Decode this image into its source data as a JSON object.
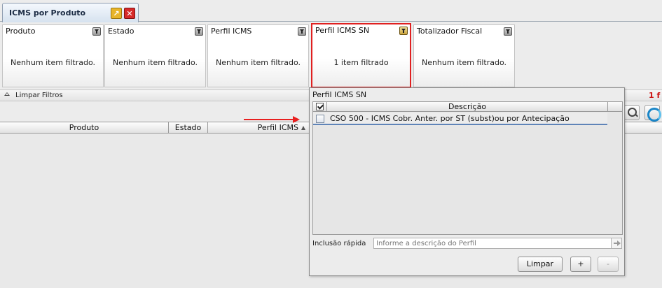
{
  "tab": {
    "title": "ICMS por Produto"
  },
  "filters": [
    {
      "title": "Produto",
      "status": "Nenhum item filtrado."
    },
    {
      "title": "Estado",
      "status": "Nenhum item filtrado."
    },
    {
      "title": "Perfil ICMS",
      "status": "Nenhum item filtrado."
    },
    {
      "title": "Perfil ICMS SN",
      "status": "1 item filtrado"
    },
    {
      "title": "Totalizador Fiscal",
      "status": "Nenhum item filtrado."
    }
  ],
  "clear_filters": {
    "label": "Limpar Filtros",
    "count_partial": "1 f"
  },
  "table": {
    "columns": [
      "Produto",
      "Estado",
      "Perfil ICMS"
    ]
  },
  "popup": {
    "title": "Perfil ICMS SN",
    "list_header": "Descrição",
    "items": [
      {
        "label": "CSO 500 - ICMS Cobr. Anter. por ST (subst)ou por Antecipação",
        "checked": false
      }
    ],
    "quick_add_label": "Inclusão rápida",
    "quick_add_placeholder": "Informe a descrição do Perfil",
    "buttons": {
      "clear": "Limpar",
      "add": "+",
      "remove": "-"
    }
  },
  "colors": {
    "highlight": "#e02020",
    "selection_line": "#5f84b8",
    "count_red": "#cc1111"
  },
  "icons": [
    "forward-icon",
    "close-icon",
    "filter-icon",
    "collapse-icon",
    "search-icon",
    "refresh-icon",
    "sort-asc-icon",
    "arrow-right-icon"
  ]
}
